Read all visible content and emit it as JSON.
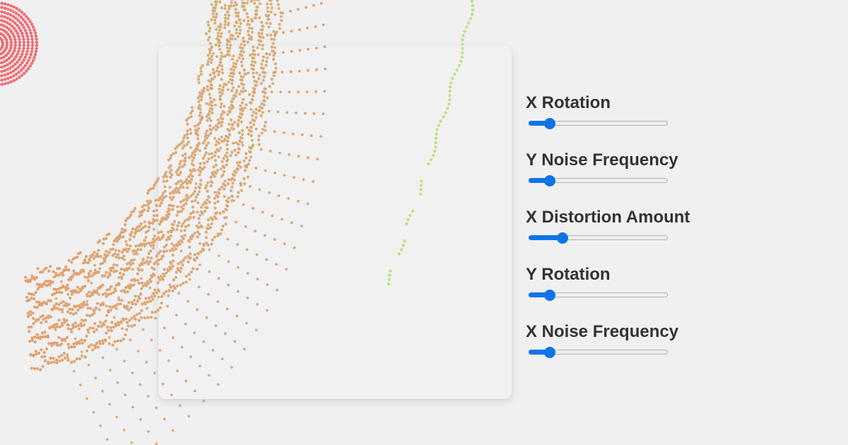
{
  "controls": [
    {
      "label": "X Rotation",
      "value": 0.12
    },
    {
      "label": "Y Noise Frequency",
      "value": 0.12
    },
    {
      "label": "X Distortion Amount",
      "value": 0.22
    },
    {
      "label": "Y Rotation",
      "value": 0.12
    },
    {
      "label": "X Noise Frequency",
      "value": 0.12
    }
  ],
  "colors": {
    "accent": "#0d74e7",
    "background": "#f0f0f0",
    "panel": "#f1f1f1",
    "label_text": "#333333",
    "dots_red": "#ef6a72",
    "dots_orange": "#e2a070",
    "dots_tan": "#d6b07a",
    "dots_green": "#bde28a"
  }
}
